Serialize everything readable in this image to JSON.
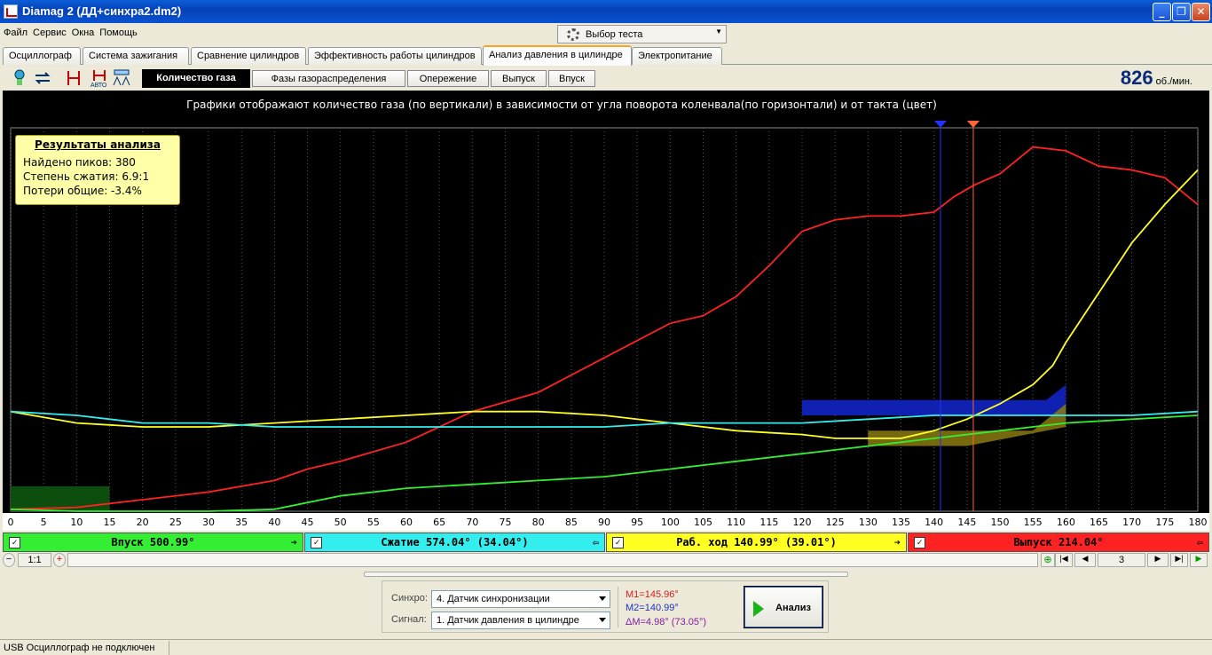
{
  "window": {
    "title": "Diamag 2 (ДД+синхра2.dm2)",
    "controls": [
      "minimize",
      "maximize",
      "close"
    ]
  },
  "menu": [
    "Файл",
    "Сервис",
    "Окна",
    "Помощь"
  ],
  "test_select": {
    "label": "Выбор теста"
  },
  "main_tabs": [
    "Осциллограф",
    "Система зажигания",
    "Сравнение цилиндров",
    "Эффективность работы цилиндров",
    "Анализ давления в цилиндре",
    "Электропитание"
  ],
  "main_tab_active": "Анализ давления в цилиндре",
  "toolbar_icons": [
    "pressure-sensor-icon",
    "sync-icon",
    "cursor-markers-icon",
    "auto-markers-icon",
    "scale-icon"
  ],
  "sub_tabs": [
    "Количество газа",
    "Фазы газораспределения",
    "Опережение",
    "Выпуск",
    "Впуск"
  ],
  "sub_tab_active": "Количество газа",
  "rpm": {
    "value": "826",
    "unit": "об./мин."
  },
  "chart_title": "Графики отображают количество газа (по вертикали) в зависимости от угла поворота коленвала(по горизонтали) и от такта (цвет)",
  "results": {
    "heading": "Результаты анализа",
    "lines": [
      "Найдено пиков: 380",
      "Степень сжатия: 6.9:1",
      "Потери общие: -3.4%"
    ]
  },
  "strokes": [
    {
      "label": "Впуск 500.99°",
      "color": "#33ee33",
      "checked": "✓",
      "arrow": "➔"
    },
    {
      "label": "Сжатие 574.04° (34.04°)",
      "color": "#33eeee",
      "checked": "✓",
      "arrow": "⇦"
    },
    {
      "label": "Раб. ход 140.99° (39.01°)",
      "color": "#ffff22",
      "checked": "✓",
      "arrow": "➔"
    },
    {
      "label": "Выпуск 214.04°",
      "color": "#ff2222",
      "checked": "✓",
      "arrow": "⇦"
    }
  ],
  "zoom": {
    "label": "1:1",
    "page": "3"
  },
  "controls": {
    "sync_label": "Синхро:",
    "sync_value": "4.  Датчик синхронизации",
    "signal_label": "Сигнал:",
    "signal_value": "1.  Датчик давления в цилиндре",
    "m1": "M1=145.96°",
    "m2": "M2=140.99°",
    "dm": "ΔM=4.98° (73.05°)",
    "analyze": "Анализ"
  },
  "status": "USB Осциллограф не подключен",
  "chart_data": {
    "type": "line",
    "title": "Графики отображают количество газа (по вертикали) в зависимости от угла поворота коленвала(по горизонтали) и от такта (цвет)",
    "xlabel": "",
    "ylabel": "",
    "xlim": [
      0,
      180
    ],
    "x_ticks": [
      0,
      5,
      10,
      15,
      20,
      25,
      30,
      35,
      40,
      45,
      50,
      55,
      60,
      65,
      70,
      75,
      80,
      85,
      90,
      95,
      100,
      105,
      110,
      115,
      120,
      125,
      130,
      135,
      140,
      145,
      150,
      155,
      160,
      165,
      170,
      175,
      180
    ],
    "grid": "vertical dotted",
    "markers": [
      {
        "name": "M1",
        "x": 145.96,
        "color": "#ff6633"
      },
      {
        "name": "M2",
        "x": 140.99,
        "color": "#2233ff"
      }
    ],
    "series": [
      {
        "color": "#ff2222",
        "x": [
          0,
          10,
          20,
          30,
          40,
          45,
          50,
          60,
          65,
          70,
          80,
          90,
          100,
          105,
          110,
          115,
          120,
          125,
          130,
          135,
          140,
          143,
          146,
          150,
          155,
          160,
          165,
          170,
          175,
          180
        ],
        "y": [
          0.5,
          1,
          3,
          5,
          8,
          11,
          13,
          18,
          22,
          26,
          31,
          40,
          49,
          51,
          56,
          64,
          73,
          76,
          77,
          77,
          78,
          82,
          85,
          88,
          95,
          94,
          90,
          89,
          87,
          80
        ]
      },
      {
        "color": "#ffff22",
        "x": [
          0,
          10,
          20,
          30,
          40,
          50,
          60,
          70,
          80,
          90,
          100,
          110,
          120,
          125,
          130,
          135,
          140,
          145,
          150,
          155,
          158,
          160,
          165,
          170,
          175,
          180
        ],
        "y": [
          26,
          23,
          22,
          22,
          23,
          24,
          25,
          26,
          26,
          25,
          23,
          21,
          20,
          19,
          19,
          19,
          21,
          24,
          28,
          33,
          38,
          44,
          57,
          70,
          80,
          89
        ]
      },
      {
        "color": "#33eeee",
        "x": [
          0,
          10,
          20,
          30,
          40,
          50,
          60,
          70,
          80,
          90,
          100,
          110,
          120,
          130,
          140,
          150,
          160,
          170,
          180
        ],
        "y": [
          26,
          25,
          23,
          23,
          22,
          22,
          22,
          22,
          22,
          22,
          23,
          23,
          23,
          24,
          25,
          25,
          25,
          25,
          26
        ]
      },
      {
        "color": "#33ee33",
        "x": [
          0,
          10,
          20,
          30,
          40,
          50,
          60,
          70,
          80,
          90,
          100,
          110,
          120,
          130,
          140,
          150,
          160,
          170,
          180
        ],
        "y": [
          0.5,
          0,
          0,
          0,
          0.5,
          4,
          6,
          7,
          8,
          9,
          11,
          13,
          15,
          17,
          19,
          21,
          23,
          24,
          25
        ]
      }
    ]
  }
}
